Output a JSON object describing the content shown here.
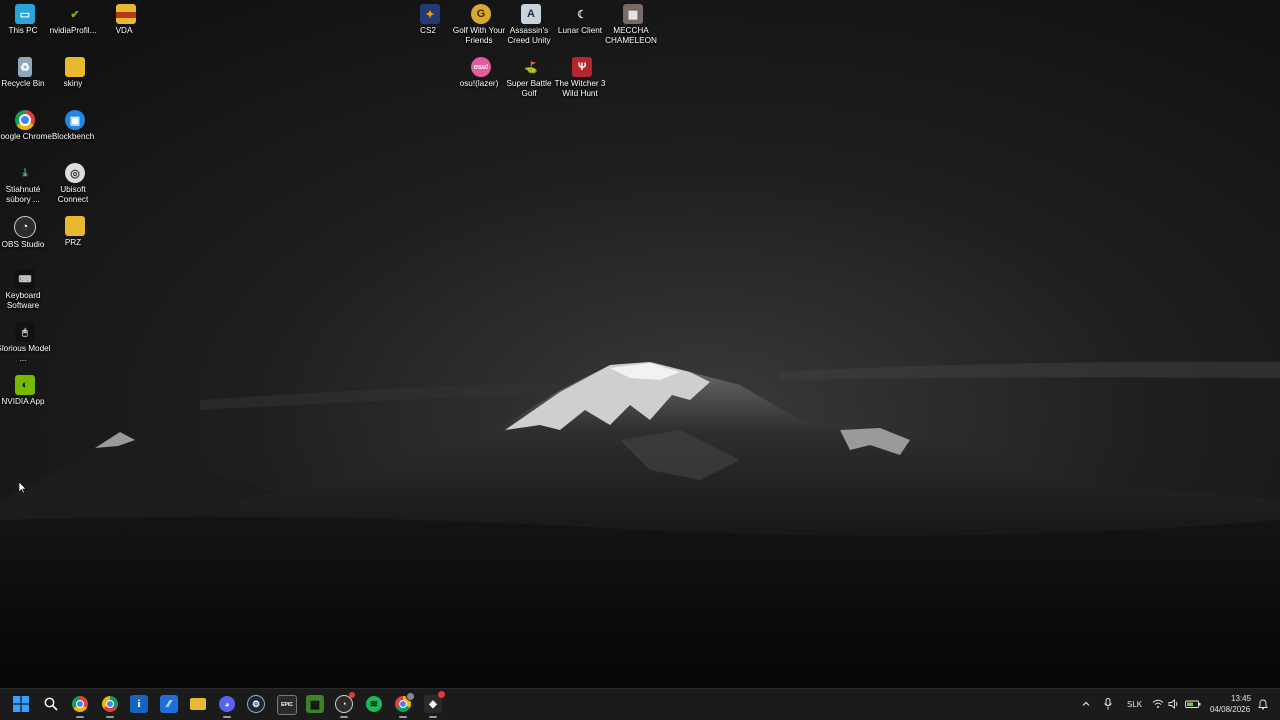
{
  "desktop": {
    "icons": [
      {
        "label": "This PC",
        "icon": "computer-icon"
      },
      {
        "label": "nvidiaProfil...",
        "icon": "nvidia-icon"
      },
      {
        "label": "VDA",
        "icon": "folder-icon"
      },
      {
        "label": "Recycle Bin",
        "icon": "recycle-bin-icon"
      },
      {
        "label": "skiny",
        "icon": "folder-icon"
      },
      {
        "label": "Google Chrome",
        "icon": "chrome-icon"
      },
      {
        "label": "Blockbench",
        "icon": "blockbench-icon"
      },
      {
        "label": "Stiahnuté súbory ...",
        "icon": "downloads-icon"
      },
      {
        "label": "Ubisoft Connect",
        "icon": "ubisoft-icon"
      },
      {
        "label": "OBS Studio",
        "icon": "obs-icon"
      },
      {
        "label": "PRZ",
        "icon": "folder-icon"
      },
      {
        "label": "Keyboard Software",
        "icon": "keyboard-software-icon"
      },
      {
        "label": "Glorious Model ...",
        "icon": "mouse-software-icon"
      },
      {
        "label": "NVIDIA App",
        "icon": "nvidia-app-icon"
      },
      {
        "label": "CS2",
        "icon": "cs2-icon"
      },
      {
        "label": "Golf With Your Friends",
        "icon": "golf-icon"
      },
      {
        "label": "Assassin's Creed Unity",
        "icon": "assassins-creed-icon"
      },
      {
        "label": "Lunar Client",
        "icon": "lunar-client-icon"
      },
      {
        "label": "MECCHA CHAMELEON",
        "icon": "meccha-chameleon-icon"
      },
      {
        "label": "osu!(lazer)",
        "icon": "osu-icon"
      },
      {
        "label": "Super Battle Golf",
        "icon": "super-battle-golf-icon"
      },
      {
        "label": "The Witcher 3 Wild Hunt",
        "icon": "witcher-icon"
      }
    ]
  },
  "taskbar": {
    "apps": [
      {
        "name": "start-button",
        "icon": "windows-start-icon",
        "glyph": "⊞",
        "color": "#1e90ff"
      },
      {
        "name": "search-button",
        "icon": "search-icon",
        "glyph": "⌕",
        "color": "#1b1b1b"
      },
      {
        "name": "taskbar-chrome",
        "icon": "chrome-icon",
        "glyph": "●",
        "color": "#db4437"
      },
      {
        "name": "taskbar-chrome-2",
        "icon": "chrome-icon",
        "glyph": "●",
        "color": "#0f9d58"
      },
      {
        "name": "taskbar-info",
        "icon": "info-icon",
        "glyph": "i",
        "color": "#1565c0"
      },
      {
        "name": "taskbar-blue-app",
        "icon": "app-icon",
        "glyph": "/",
        "color": "#1e6fd9"
      },
      {
        "name": "taskbar-file-explorer",
        "icon": "folder-icon",
        "glyph": "",
        "color": "#e8b830"
      },
      {
        "name": "taskbar-discord",
        "icon": "discord-icon",
        "glyph": "◉",
        "color": "#5865f2"
      },
      {
        "name": "taskbar-steam",
        "icon": "steam-icon",
        "glyph": "⚙",
        "color": "#1b2838"
      },
      {
        "name": "taskbar-epic-games",
        "icon": "epic-games-icon",
        "glyph": "EPIC",
        "color": "#2a2a2a"
      },
      {
        "name": "taskbar-minecraft",
        "icon": "minecraft-icon",
        "glyph": "▦",
        "color": "#3c8527"
      },
      {
        "name": "taskbar-obs",
        "icon": "obs-icon",
        "glyph": "◎",
        "color": "#2c2c2c"
      },
      {
        "name": "taskbar-spotify",
        "icon": "spotify-icon",
        "glyph": "≋",
        "color": "#1db954"
      },
      {
        "name": "taskbar-chrome-3",
        "icon": "chrome-icon",
        "glyph": "●",
        "color": "#4285f4"
      },
      {
        "name": "taskbar-app-badge",
        "icon": "app-with-badge-icon",
        "glyph": "◆",
        "color": "#2a2a2a"
      }
    ],
    "tray": {
      "language": "SLK",
      "time": "13:45",
      "date": "04/08/2026"
    }
  },
  "colors": {
    "taskbar_bg": "#1b1b1b",
    "accent": "#1e90ff"
  }
}
